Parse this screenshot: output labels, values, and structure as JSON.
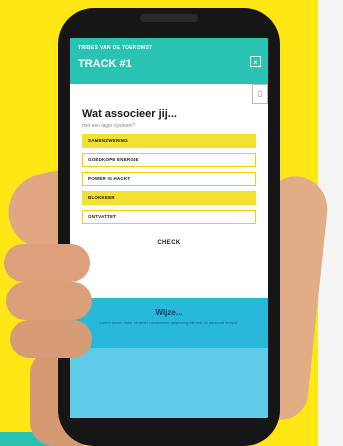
{
  "header": {
    "subtitle": "TRIBES VAN DE TOEKOMST",
    "title": "TRACK #1",
    "close_label": "×"
  },
  "corner_icon_glyph": "▯",
  "question": {
    "title": "Wat associeer jij...",
    "subtitle": "met een lager systeem?"
  },
  "answers": [
    {
      "label": "SAMENZWERING",
      "selected": true
    },
    {
      "label": "GOEDKOPE ENERGIE",
      "selected": false
    },
    {
      "label": "POWER IS HACKT",
      "selected": false
    },
    {
      "label": "BLOKKEER",
      "selected": true
    },
    {
      "label": "ONTVATTET",
      "selected": false
    }
  ],
  "check_label": "CHECK",
  "tip": {
    "title": "Wijze...",
    "text": "Lorem ipsum dolor sit amet consectetur adipiscing elit sed do eiusmod tempor."
  },
  "colors": {
    "background": "#FFE614",
    "header": "#29C3B4",
    "answer_selected": "#F2E130",
    "tip": "#27B8DA"
  }
}
